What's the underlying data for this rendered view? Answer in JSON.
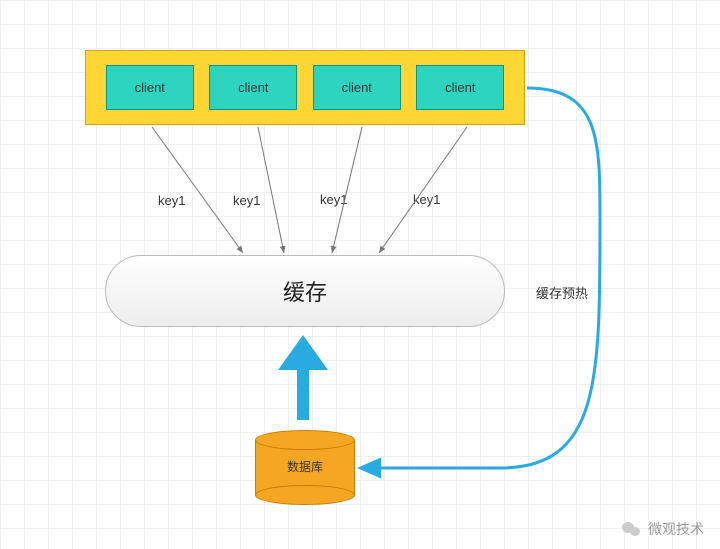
{
  "clients": [
    "client",
    "client",
    "client",
    "client"
  ],
  "requests": [
    "key1",
    "key1",
    "key1",
    "key1"
  ],
  "cache_label": "缓存",
  "db_label": "数据库",
  "preheat_label": "缓存预热",
  "watermark": "微观技术",
  "chart_data": {
    "type": "diagram",
    "title": "Cache preheating architecture",
    "nodes": [
      {
        "id": "client1",
        "label": "client",
        "type": "client"
      },
      {
        "id": "client2",
        "label": "client",
        "type": "client"
      },
      {
        "id": "client3",
        "label": "client",
        "type": "client"
      },
      {
        "id": "client4",
        "label": "client",
        "type": "client"
      },
      {
        "id": "cache",
        "label": "缓存",
        "type": "cache"
      },
      {
        "id": "db",
        "label": "数据库",
        "type": "database"
      }
    ],
    "edges": [
      {
        "from": "client1",
        "to": "cache",
        "label": "key1"
      },
      {
        "from": "client2",
        "to": "cache",
        "label": "key1"
      },
      {
        "from": "client3",
        "to": "cache",
        "label": "key1"
      },
      {
        "from": "client4",
        "to": "cache",
        "label": "key1"
      },
      {
        "from": "db",
        "to": "cache",
        "label": "",
        "style": "up-arrow"
      },
      {
        "from": "client-group",
        "to": "db",
        "label": "缓存预热",
        "style": "curved"
      }
    ]
  }
}
